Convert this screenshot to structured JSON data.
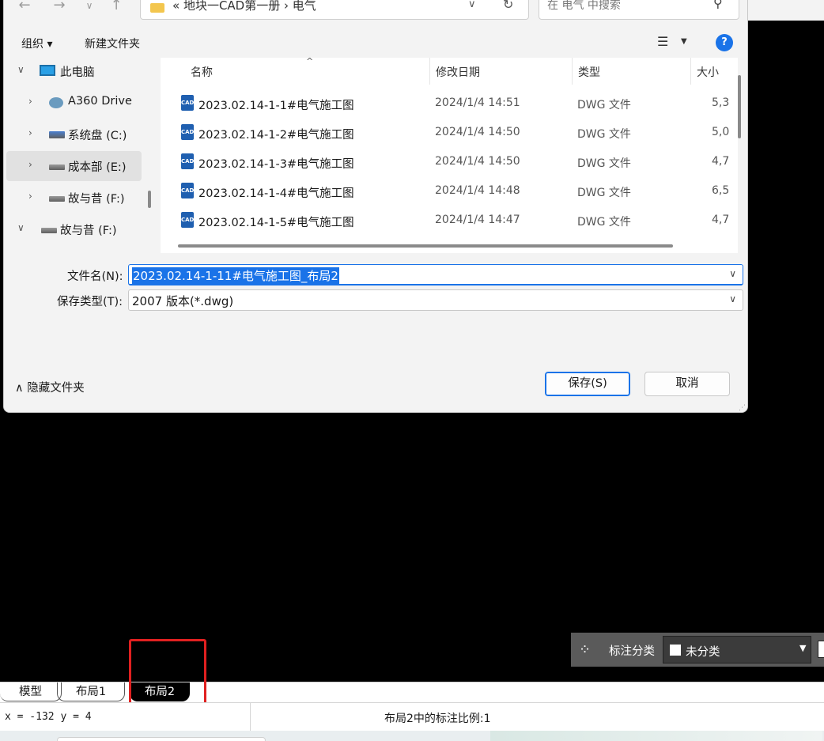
{
  "dialog": {
    "address": {
      "crumb": "« 地块一CAD第一册  ›  电气"
    },
    "search": {
      "placeholder": "在 电气 中搜索"
    },
    "toolbar": {
      "organize": "组织 ▾",
      "new_folder": "新建文件夹"
    },
    "nav": [
      {
        "label": "此电脑",
        "icon": "computer-icon",
        "expander": "∨"
      },
      {
        "label": "A360 Drive",
        "icon": "cloud-drive-icon",
        "expander": "›"
      },
      {
        "label": "系统盘 (C:)",
        "icon": "drive-icon",
        "expander": "›"
      },
      {
        "label": "成本部 (E:)",
        "icon": "drive-icon",
        "expander": "›",
        "selected": true
      },
      {
        "label": "故与昔 (F:)",
        "icon": "drive-icon",
        "expander": "›"
      },
      {
        "label": "故与昔 (F:)",
        "icon": "drive-icon",
        "expander": "∨"
      }
    ],
    "columns": {
      "name": "名称",
      "modified": "修改日期",
      "type": "类型",
      "size": "大小"
    },
    "files": [
      {
        "name": "2023.02.14-1-1#电气施工图",
        "modified": "2024/1/4 14:51",
        "type": "DWG 文件",
        "size": "5,3"
      },
      {
        "name": "2023.02.14-1-2#电气施工图",
        "modified": "2024/1/4 14:50",
        "type": "DWG 文件",
        "size": "5,0"
      },
      {
        "name": "2023.02.14-1-3#电气施工图",
        "modified": "2024/1/4 14:50",
        "type": "DWG 文件",
        "size": "4,7"
      },
      {
        "name": "2023.02.14-1-4#电气施工图",
        "modified": "2024/1/4 14:48",
        "type": "DWG 文件",
        "size": "6,5"
      },
      {
        "name": "2023.02.14-1-5#电气施工图",
        "modified": "2024/1/4 14:47",
        "type": "DWG 文件",
        "size": "4,7"
      }
    ],
    "file_icon_text": "CAD",
    "filename_label": "文件名(N):",
    "filename_value": "2023.02.14-1-11#电气施工图_布局2",
    "filetype_label": "保存类型(T):",
    "filetype_value": "2007 版本(*.dwg)",
    "hide_folders": "隐藏文件夹",
    "save_button": "保存(S)",
    "cancel_button": "取消"
  },
  "annotation_bar": {
    "label": "标注分类",
    "selected": "未分类"
  },
  "tabs": [
    "模型",
    "布局1",
    "布局2"
  ],
  "active_tab": "布局2",
  "status": {
    "coords": "x = -132 y = 4",
    "scale_text": "布局2中的标注比例:1"
  },
  "colors": {
    "accent": "#1a73e8",
    "highlight_box": "#e02020",
    "canvas": "#000000"
  }
}
